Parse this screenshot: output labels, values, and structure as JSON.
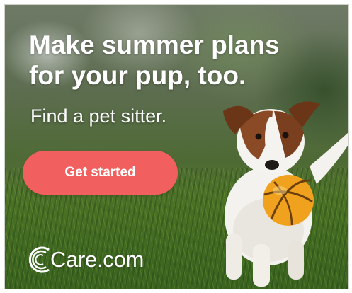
{
  "ad": {
    "headline_line1": "Make summer plans",
    "headline_line2": "for your pup, too.",
    "subheadline": "Find a pet sitter.",
    "cta_label": "Get started",
    "brand_name": "Care.com",
    "accent_color": "#f1605f",
    "image_subject": "dog running on grass with orange ball"
  }
}
